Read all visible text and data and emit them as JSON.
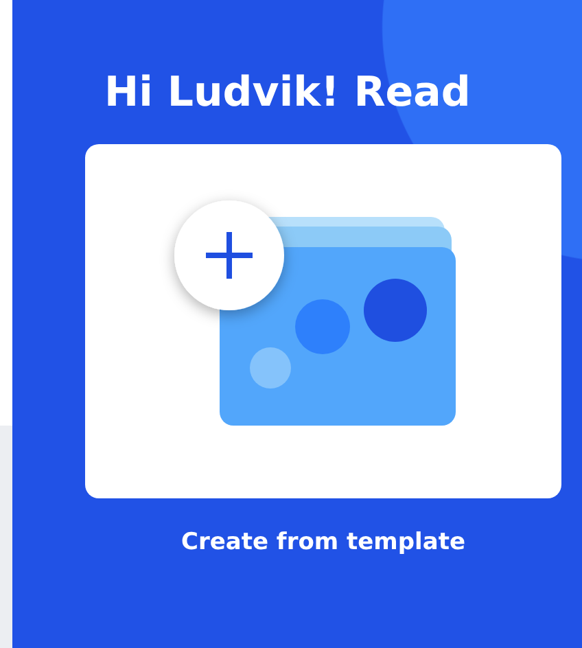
{
  "greeting": "Hi Ludvik! Read",
  "template_tile": {
    "label": "Create from template"
  }
}
